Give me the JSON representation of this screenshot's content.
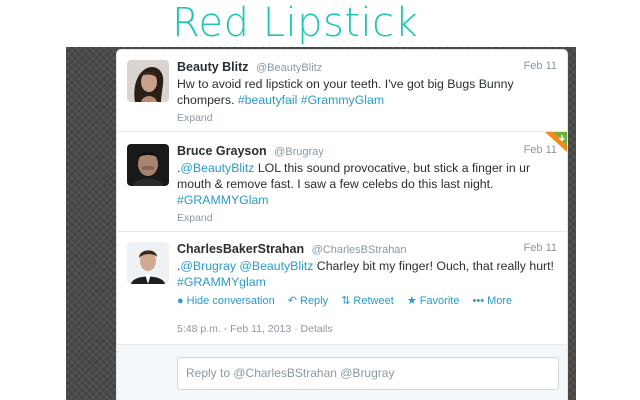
{
  "page_title": "Red Lipstick",
  "colors": {
    "title": "#1fc7b3",
    "link": "#2a9bc7",
    "badge_orange": "#f08c1e",
    "badge_green": "#6ab43e"
  },
  "tweets": [
    {
      "fullname": "Beauty Blitz",
      "username": "@BeautyBlitz",
      "timestamp": "Feb 11",
      "text": [
        {
          "t": "Hw to avoid red lipstick on your teeth. I've got big Bugs Bunny chompers. "
        },
        {
          "t": "#beautyfail",
          "link": true
        },
        {
          "t": " "
        },
        {
          "t": "#GrammyGlam",
          "link": true
        }
      ],
      "expand": "Expand"
    },
    {
      "fullname": "Bruce Grayson",
      "username": "@Brugray",
      "timestamp": "Feb 11",
      "text": [
        {
          "t": "."
        },
        {
          "t": "@BeautyBlitz",
          "link": true
        },
        {
          "t": " LOL this sound provocative, but stick a finger in ur mouth & remove fast. I saw a few celebs do this last night. "
        },
        {
          "t": "#GRAMMYGlam",
          "link": true
        }
      ],
      "expand": "Expand"
    },
    {
      "fullname": "CharlesBakerStrahan",
      "username": "@CharlesBStrahan",
      "timestamp": "Feb 11",
      "text": [
        {
          "t": "."
        },
        {
          "t": "@Brugray",
          "link": true
        },
        {
          "t": " "
        },
        {
          "t": "@BeautyBlitz",
          "link": true
        },
        {
          "t": " Charley bit my finger! Ouch, that really hurt! "
        },
        {
          "t": "#GRAMMYglam",
          "link": true
        }
      ],
      "actions": {
        "hide_conversation": "Hide conversation",
        "reply": "Reply",
        "retweet": "Retweet",
        "favorite": "Favorite",
        "more": "More"
      },
      "icons": [
        "speech-bubble-icon",
        "reply-arrow-icon",
        "retweet-icon",
        "star-icon",
        "ellipsis-icon"
      ],
      "meta_time": "5:48 p.m. - Feb 11, 2013 · Details"
    }
  ],
  "reply_placeholder": "Reply to @CharlesBStrahan @Brugray"
}
